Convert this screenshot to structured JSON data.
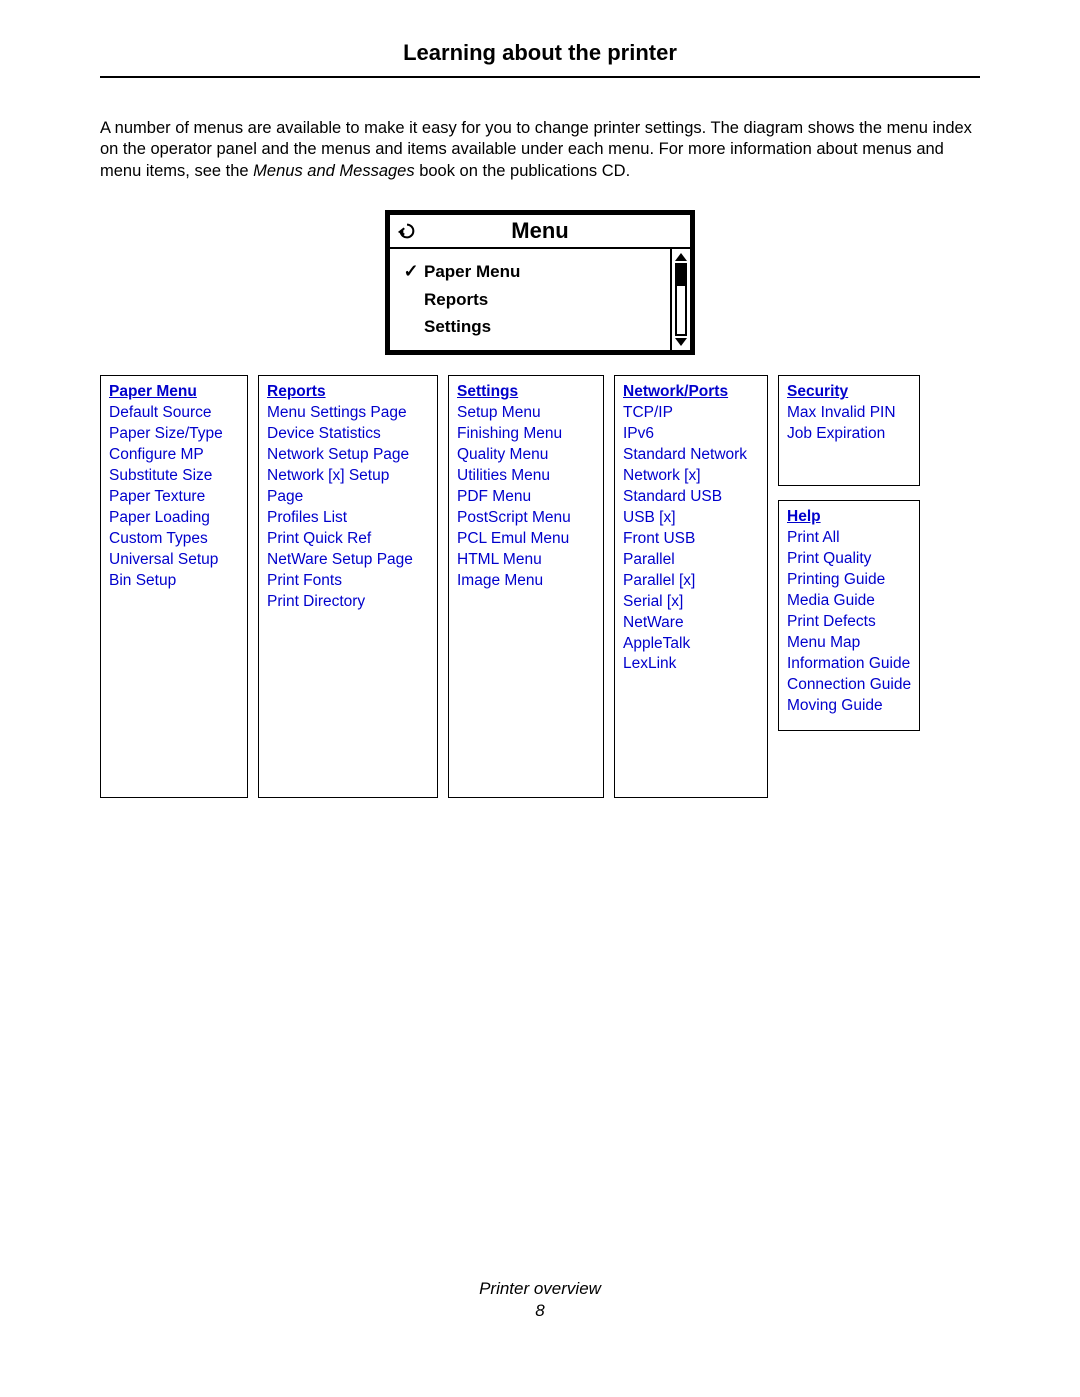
{
  "title": "Learning about the printer",
  "intro_part1": "A number of menus are available to make it easy for you to change printer settings. The diagram shows the menu index on the operator panel and the menus and items available under each menu. For more information about menus and menu items, see the ",
  "intro_italic": "Menus and Messages",
  "intro_part2": " book on the publications CD.",
  "panel": {
    "title": "Menu",
    "items": [
      "Paper Menu",
      "Reports",
      "Settings"
    ],
    "selected_index": 0
  },
  "columns": {
    "paper_menu": {
      "head": "Paper Menu",
      "items": [
        "Default Source",
        "Paper Size/Type",
        "Configure MP",
        "Substitute Size",
        "Paper Texture",
        "Paper Loading",
        "Custom Types",
        "Universal Setup",
        "Bin Setup"
      ]
    },
    "reports": {
      "head": "Reports",
      "items": [
        "Menu Settings Page",
        "Device Statistics",
        "Network Setup Page",
        "Network [x] Setup Page",
        "Profiles List",
        "Print Quick Ref",
        "NetWare Setup Page",
        "Print Fonts",
        "Print Directory"
      ]
    },
    "settings": {
      "head": "Settings",
      "items": [
        "Setup Menu",
        "Finishing Menu",
        "Quality Menu",
        "Utilities Menu",
        "PDF Menu",
        "PostScript Menu",
        "PCL Emul Menu",
        "HTML Menu",
        "Image Menu"
      ]
    },
    "network": {
      "head": "Network/Ports",
      "items": [
        "TCP/IP",
        "IPv6",
        "Standard Network",
        "Network [x]",
        "Standard USB",
        "USB [x]",
        "Front USB",
        "Parallel",
        "Parallel [x]",
        "Serial [x]",
        "NetWare",
        "AppleTalk",
        "LexLink"
      ]
    },
    "security": {
      "head": "Security",
      "items": [
        "Max Invalid PIN",
        "Job Expiration"
      ]
    },
    "help": {
      "head": "Help",
      "items": [
        "Print All",
        "Print Quality",
        "Printing Guide",
        "Media Guide",
        "Print Defects",
        "Menu Map",
        "Information Guide",
        "Connection Guide",
        "Moving Guide"
      ]
    }
  },
  "footer": {
    "section": "Printer overview",
    "page": "8"
  }
}
